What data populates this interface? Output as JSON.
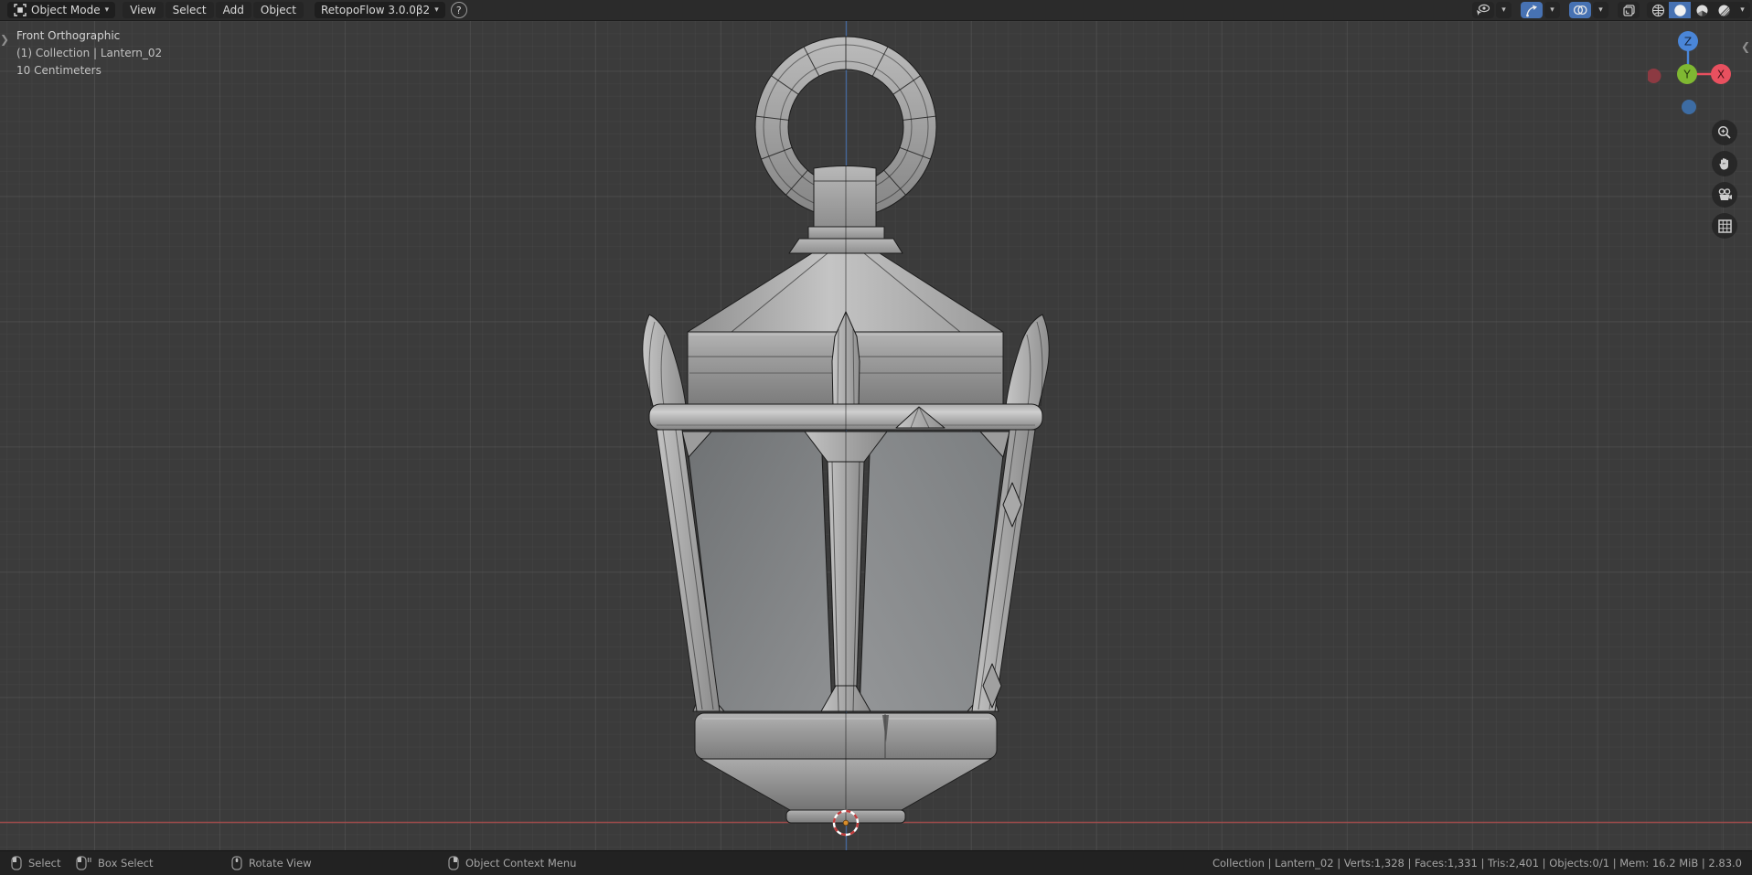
{
  "header": {
    "mode_label": "Object Mode",
    "menus": [
      "View",
      "Select",
      "Add",
      "Object"
    ],
    "addon_label": "RetopoFlow 3.0.0β2",
    "help_label": "?",
    "accent_color": "#4772b3"
  },
  "overlay": {
    "view_label": "Front Orthographic",
    "context_label": "(1) Collection | Lantern_02",
    "grid_scale_label": "10 Centimeters"
  },
  "gizmo": {
    "z_label": "Z",
    "y_label": "Y",
    "x_label": "X",
    "x_color": "#e8505f",
    "y_color": "#7fb832",
    "z_color": "#4a86d8",
    "neg_x_color": "#8c3a42",
    "neg_z_color": "#3d6ca3"
  },
  "status": {
    "hints": [
      {
        "label": "Select",
        "button": "left-mouse"
      },
      {
        "label": "Box Select",
        "button": "left-mouse-drag"
      },
      {
        "label": "Rotate View",
        "button": "middle-mouse"
      },
      {
        "label": "Object Context Menu",
        "button": "right-mouse"
      }
    ],
    "stats_text": "Collection | Lantern_02 | Verts:1,328 | Faces:1,331 | Tris:2,401 | Objects:0/1 | Mem: 16.2 MiB | 2.83.0"
  },
  "scene_info": {
    "object_name": "Lantern_02",
    "axis_x_line_color": "#a34c4c",
    "axis_z_line_color": "#44699e",
    "cursor_colors": {
      "ring_red": "#c23c3c",
      "ring_white": "#ffffff",
      "center": "#d98d2b"
    }
  }
}
